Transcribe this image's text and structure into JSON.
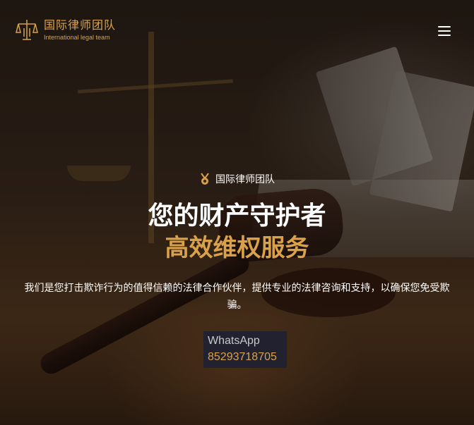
{
  "brand": {
    "name_cn": "国际律师团队",
    "name_en": "International legal team",
    "accent_color": "#d9a24a"
  },
  "header": {
    "menu_icon": "hamburger-menu-icon"
  },
  "hero": {
    "badge_icon": "medal-icon",
    "badge_text": "国际律师团队",
    "headline": "您的财产守护者",
    "subheadline": "高效维权服务",
    "description": "我们是您打击欺诈行为的值得信赖的法律合作伙伴，提供专业的法律咨询和支持，以确保您免受欺骗。"
  },
  "contact": {
    "label": "WhatsApp",
    "number": "85293718705"
  }
}
